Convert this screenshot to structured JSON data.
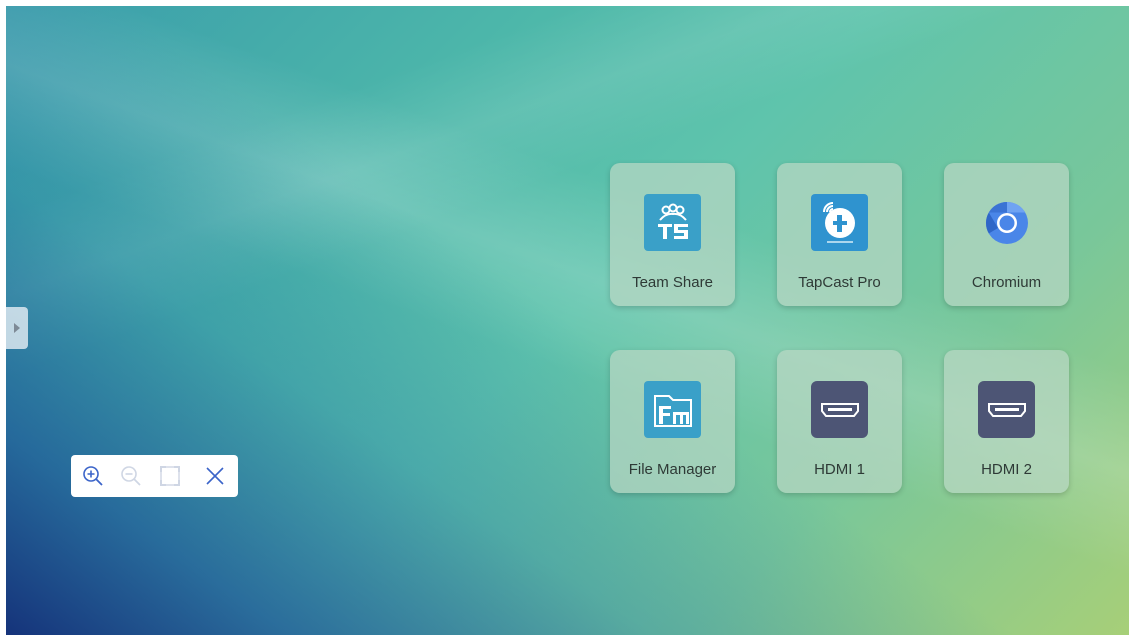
{
  "side_panel": {
    "toggle_icon": "triangle-right-icon"
  },
  "apps": [
    {
      "label": "Team Share",
      "icon": "team-share-icon",
      "color": "#3aa0c8"
    },
    {
      "label": "TapCast Pro",
      "icon": "tapcast-pro-icon",
      "color": "#2f93cf"
    },
    {
      "label": "Chromium",
      "icon": "chromium-icon",
      "color": "#4a86e8"
    },
    {
      "label": "File Manager",
      "icon": "file-manager-icon",
      "color": "#3aa0c8"
    },
    {
      "label": "HDMI 1",
      "icon": "hdmi-icon",
      "color": "#4d5575"
    },
    {
      "label": "HDMI 2",
      "icon": "hdmi-icon",
      "color": "#4d5575"
    }
  ],
  "zoom_toolbar": {
    "tools": [
      "zoom-in-icon",
      "zoom-out-icon",
      "fit-screen-icon",
      "close-icon"
    ],
    "active_color": "#3b64c9",
    "disabled_color": "#cfd6e4"
  },
  "theme": {
    "tile_label_color": "#2e3a36"
  }
}
